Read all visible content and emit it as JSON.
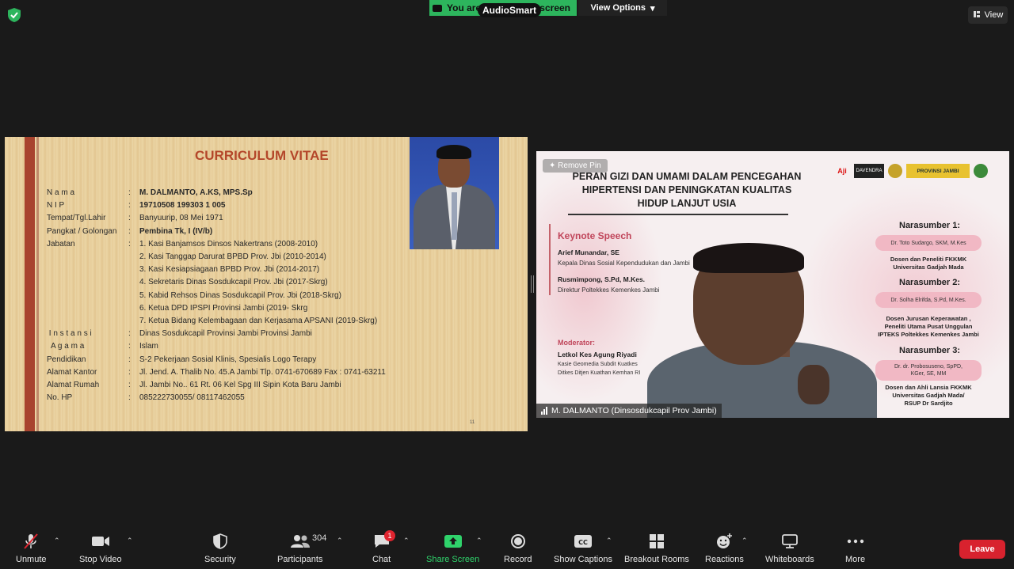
{
  "top": {
    "banner_left": "You are",
    "banner_right": "'s screen",
    "audiosmart": "AudioSmart",
    "view_options": "View Options",
    "view": "View"
  },
  "cv": {
    "title": "CURRICULUM VITAE",
    "colon": ":",
    "page": "11",
    "rows": [
      {
        "label": "N a m a",
        "value": "M. DALMANTO, A.KS, MPS.Sp"
      },
      {
        "label": "N I P",
        "value": "19710508 199303 1 005"
      },
      {
        "label": "Tempat/Tgl.Lahir",
        "value": "Banyuurip, 08 Mei 1971"
      },
      {
        "label": "Pangkat / Golongan",
        "value": "Pembina Tk, I (IV/b)"
      },
      {
        "label": "Jabatan",
        "value": ""
      },
      {
        "label": " I n s t a n s i",
        "value": "Dinas Sosdukcapil Provinsi Jambi Provinsi Jambi"
      },
      {
        "label": "  A g a m a",
        "value": "Islam"
      },
      {
        "label": "Pendidikan",
        "value": "S-2 Pekerjaan Sosial Klinis, Spesialis Logo Terapy"
      },
      {
        "label": "Alamat Kantor",
        "value": "Jl. Jend. A. Thalib No. 45.A Jambi Tlp. 0741-670689 Fax : 0741-63211"
      },
      {
        "label": "Alamat Rumah",
        "value": "Jl. Jambi No.. 61 Rt. 06 Kel Spg III Sipin Kota Baru Jambi"
      },
      {
        "label": "No. HP",
        "value": "085222730055/ 08117462055"
      }
    ],
    "jabatan": [
      "1. Kasi Banjamsos Dinsos Nakertrans (2008-2010)",
      "2. Kasi Tanggap Darurat BPBD Prov. Jbi (2010-2014)",
      "3. Kasi Kesiapsiagaan BPBD Prov. Jbi (2014-2017)",
      "4. Sekretaris Dinas Sosdukcapil Prov. Jbi (2017-Skrg)",
      "5. Kabid Rehsos Dinas Sosdukcapil Prov. Jbi (2018-Skrg)",
      "6. Ketua DPD IPSPI Provinsi Jambi (2019- Skrg",
      "7. Ketua Bidang Kelembagaan dan Kerjasama APSANI (2019-Skrg)"
    ]
  },
  "video": {
    "remove_pin": "Remove Pin",
    "title": [
      "PERAN GIZI DAN UMAMI DALAM PENCEGAHAN",
      "HIPERTENSI DAN PENINGKATAN KUALITAS",
      "HIDUP LANJUT USIA"
    ],
    "logos": [
      "Aji",
      "DAVENDRA",
      "PROVINSI JAMBI"
    ],
    "keynote": "Keynote Speech",
    "speakers": [
      {
        "name": "Arief Munandar, SE",
        "role": "Kepala Dinas Sosial Kependudukan dan                    Jambi"
      },
      {
        "name": "Rusmimpong, S.Pd, M.Kes.",
        "role": "Direktur Poltekkes Kemenkes Jambi"
      }
    ],
    "moderator_heading": "Moderator:",
    "moderator": {
      "name": "Letkol Kes Agung Riyadi",
      "role1": "Kasie Geomedia Subdit Kuatkes",
      "role2": "Ditkes Ditjen Kuathan Kemhan RI"
    },
    "narasumber": [
      {
        "heading": "Narasumber 1:",
        "name": "Dr. Toto Sudargo, SKM, M.Kes",
        "desc": [
          "Dosen dan Peneliti FKKMK",
          "Universitas Gadjah Mada"
        ]
      },
      {
        "heading": "Narasumber 2:",
        "name": "Dr. Solha Elrifda, S.Pd, M.Kes.",
        "desc": [
          "Dosen Jurusan Keperawatan ,",
          "Peneliti Utama Pusat Unggulan",
          "IPTEKS Poltekkes Kemenkes Jambi"
        ]
      },
      {
        "heading": "Narasumber 3:",
        "name": [
          "Dr. dr. Probosuseno, SpPD,",
          "KGer, SE, MM"
        ],
        "desc": [
          "Dosen dan Ahli Lansia FKKMK",
          "Universitas Gadjah Mada/",
          "RSUP Dr Sardjito"
        ]
      }
    ],
    "participant": "M. DALMANTO (Dinsosdukcapil Prov Jambi)"
  },
  "toolbar": {
    "unmute": "Unmute",
    "stop_video": "Stop Video",
    "security": "Security",
    "participants": "Participants",
    "participant_count": "304",
    "chat": "Chat",
    "chat_badge": "1",
    "share_screen": "Share Screen",
    "record": "Record",
    "show_captions": "Show Captions",
    "breakout_rooms": "Breakout Rooms",
    "reactions": "Reactions",
    "whiteboards": "Whiteboards",
    "more": "More",
    "leave": "Leave"
  },
  "colors": {
    "share_green": "#2db55d",
    "leave_red": "#d8222e",
    "cv_title": "#b4472a",
    "keynote_pink": "#c0455a"
  }
}
